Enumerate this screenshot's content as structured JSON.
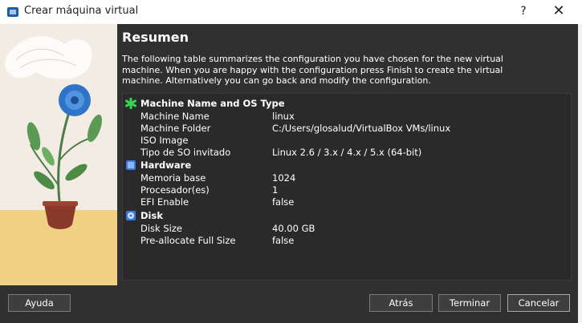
{
  "window": {
    "title": "Crear máquina virtual",
    "help_label": "?",
    "close_label": "✕"
  },
  "page": {
    "heading": "Resumen",
    "description": "The following table summarizes the configuration you have chosen for the new virtual machine. When you are happy with the configuration press Finish to create the virtual machine. Alternatively you can go back and modify the configuration."
  },
  "sections": [
    {
      "title": "Machine Name and OS Type",
      "icon": "green-asterisk-icon",
      "rows": [
        {
          "key": "Machine Name",
          "value": "linux"
        },
        {
          "key": "Machine Folder",
          "value": "C:/Users/glosalud/VirtualBox VMs/linux"
        },
        {
          "key": "ISO Image",
          "value": ""
        },
        {
          "key": "Tipo de SO invitado",
          "value": "Linux 2.6 / 3.x / 4.x / 5.x (64-bit)"
        }
      ]
    },
    {
      "title": "Hardware",
      "icon": "chip-icon",
      "rows": [
        {
          "key": "Memoria base",
          "value": "1024"
        },
        {
          "key": "Procesador(es)",
          "value": "1"
        },
        {
          "key": "EFI Enable",
          "value": "false"
        }
      ]
    },
    {
      "title": "Disk",
      "icon": "disk-icon",
      "rows": [
        {
          "key": "Disk Size",
          "value": "40.00 GB"
        },
        {
          "key": "Pre-allocate Full Size",
          "value": "false"
        }
      ]
    }
  ],
  "buttons": {
    "help": "Ayuda",
    "back": "Atrás",
    "finish": "Terminar",
    "cancel": "Cancelar"
  },
  "colors": {
    "dialog_bg": "#303030",
    "table_bg": "#2a2a2a",
    "accent_green": "#39d353",
    "accent_blue": "#3b78e7"
  }
}
